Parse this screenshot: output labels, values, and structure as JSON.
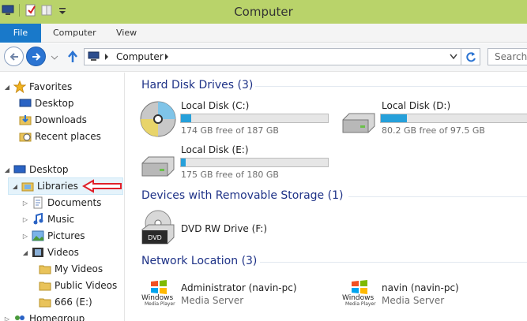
{
  "window": {
    "title": "Computer"
  },
  "ribbon": {
    "tabs": [
      "File",
      "Computer",
      "View"
    ]
  },
  "address": {
    "path": "Computer",
    "search_placeholder": "Search C"
  },
  "nav": {
    "favorites": "Favorites",
    "desktop_fav": "Desktop",
    "downloads": "Downloads",
    "recent": "Recent places",
    "desktop": "Desktop",
    "libraries": "Libraries",
    "documents": "Documents",
    "music": "Music",
    "pictures": "Pictures",
    "videos": "Videos",
    "my_videos": "My Videos",
    "public_videos": "Public Videos",
    "e_drive": "666 (E:)",
    "homegroup": "Homegroup"
  },
  "groups": {
    "hdd": "Hard Disk Drives (3)",
    "removable": "Devices with Removable Storage (1)",
    "network": "Network Location (3)"
  },
  "drives": [
    {
      "name": "Local Disk (C:)",
      "free": "174 GB free of 187 GB",
      "used_fraction": 0.07
    },
    {
      "name": "Local Disk (D:)",
      "free": "80.2 GB free of 97.5 GB",
      "used_fraction": 0.18
    },
    {
      "name": "Local Disk (E:)",
      "free": "175 GB free of 180 GB",
      "used_fraction": 0.03
    }
  ],
  "removable": [
    {
      "name": "DVD RW Drive (F:)",
      "label": "DVD"
    }
  ],
  "network": [
    {
      "name": "Administrator (navin-pc)",
      "type": "Media Server",
      "logo_line1": "Windows",
      "logo_line2": "Media Player"
    },
    {
      "name": "navin (navin-pc)",
      "type": "Media Server",
      "logo_line1": "Windows",
      "logo_line2": "Media Player"
    }
  ],
  "colors": {
    "titlebar": "#b9d36a",
    "accent": "#1979ca",
    "progress": "#26a0da",
    "group_header": "#1e3287",
    "annotation_arrow": "#e0202a"
  }
}
